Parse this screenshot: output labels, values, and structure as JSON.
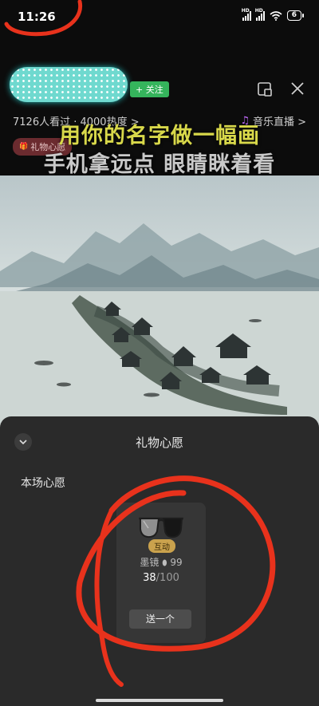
{
  "status_bar": {
    "time": "11:26",
    "hd_label": "HD",
    "battery": "6"
  },
  "header": {
    "follow_label": "+ 关注",
    "stats": "7126人看过 · 4000热度 >",
    "music_live_label": "音乐直播 >",
    "wish_chip_label": "礼物心愿"
  },
  "video": {
    "caption_line1": "用你的名字做一幅画",
    "caption_line2": "手机拿远点 眼睛眯着看"
  },
  "sheet": {
    "title": "礼物心愿",
    "section_title": "本场心愿",
    "gift": {
      "badge": "互动",
      "name": "墨镜",
      "price": "99",
      "progress_current": "38",
      "progress_total": "/100",
      "send_label": "送一个"
    }
  },
  "icons": {
    "music": "music-note-icon",
    "pip": "pip-icon",
    "close": "close-icon",
    "collapse": "chevron-down-icon",
    "gift_image": "sunglasses-icon",
    "coin": "coin-icon"
  },
  "colors": {
    "follow_green": "#35b45c",
    "badge_gold": "#caa24d",
    "caption_yellow": "#d8d84a",
    "annotation_red": "#e8321c",
    "music_purple": "#c46cff"
  }
}
